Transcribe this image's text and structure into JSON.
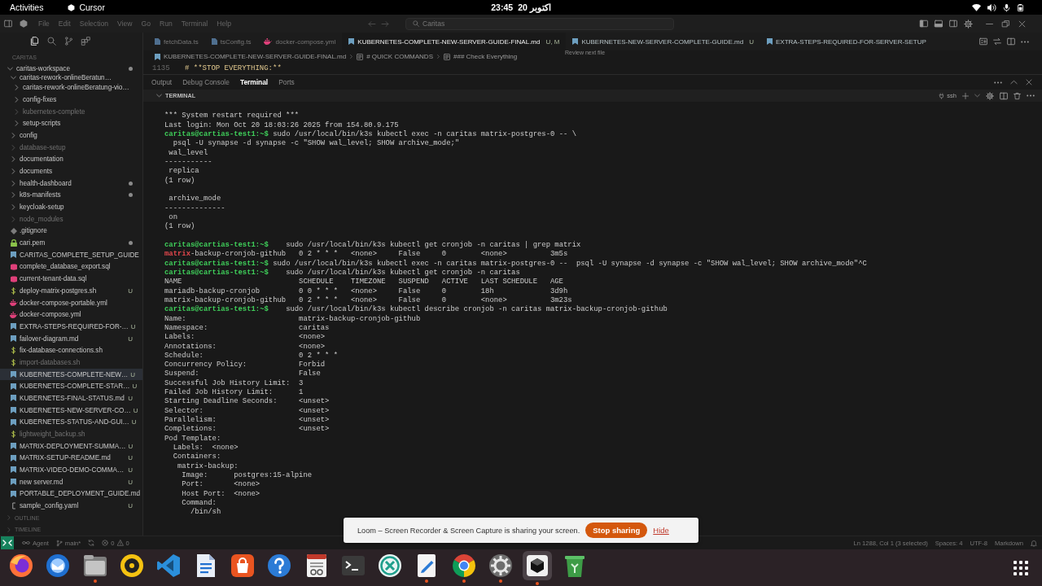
{
  "top_bar": {
    "activities": "Activities",
    "app": "Cursor",
    "time": "23:45",
    "date": "20 اکتوبر"
  },
  "title_bar": {
    "menu": [
      "File",
      "Edit",
      "Selection",
      "View",
      "Go",
      "Run",
      "Terminal",
      "Help"
    ],
    "command_center": "Caritas"
  },
  "sidebar": {
    "title": "CARITAS",
    "tree": [
      {
        "label": "caritas-workspace",
        "kind": "folder",
        "expanded": true,
        "selected": false,
        "dimmed": false,
        "dot": true,
        "children": [
          {
            "label": "caritas-rework-onlineBeratun…",
            "kind": "folder",
            "expanded": true,
            "selected": false,
            "dimmed": false,
            "dot": false,
            "children": [
              {
                "label": "caritas-rework-onlineBeratung-vio…",
                "kind": "folder",
                "expanded": false,
                "selected": false,
                "dimmed": false,
                "dot": false
              },
              {
                "label": "config-fixes",
                "kind": "folder",
                "expanded": false,
                "selected": false,
                "dimmed": false,
                "dot": false
              },
              {
                "label": "kubernetes-complete",
                "kind": "folder",
                "expanded": false,
                "selected": false,
                "dimmed": true,
                "dot": false
              },
              {
                "label": "setup-scripts",
                "kind": "folder",
                "expanded": false,
                "selected": false,
                "dimmed": false,
                "dot": false
              }
            ]
          },
          {
            "label": "config",
            "kind": "folder",
            "expanded": false,
            "selected": false,
            "dimmed": false,
            "dot": false
          },
          {
            "label": "database-setup",
            "kind": "folder",
            "expanded": false,
            "selected": false,
            "dimmed": true,
            "dot": false
          },
          {
            "label": "documentation",
            "kind": "folder",
            "expanded": false,
            "selected": false,
            "dimmed": false,
            "dot": false
          },
          {
            "label": "documents",
            "kind": "folder",
            "expanded": false,
            "selected": false,
            "dimmed": false,
            "dot": false
          },
          {
            "label": "health-dashboard",
            "kind": "folder",
            "expanded": false,
            "selected": false,
            "dimmed": false,
            "dot": true
          },
          {
            "label": "k8s-manifests",
            "kind": "folder",
            "expanded": false,
            "selected": false,
            "dimmed": false,
            "dot": true
          },
          {
            "label": "keycloak-setup",
            "kind": "folder",
            "expanded": false,
            "selected": false,
            "dimmed": false,
            "dot": false
          },
          {
            "label": "node_modules",
            "kind": "folder",
            "expanded": false,
            "selected": false,
            "dimmed": true,
            "dot": false
          },
          {
            "label": ".gitignore",
            "kind": "gitignore",
            "selected": false,
            "dimmed": false,
            "dot": false
          },
          {
            "label": "cari.pem",
            "kind": "pem",
            "selected": false,
            "dimmed": false,
            "dot": true
          },
          {
            "label": "CARITAS_COMPLETE_SETUP_GUIDE",
            "kind": "md",
            "selected": false,
            "dimmed": false,
            "dot": false
          },
          {
            "label": "complete_database_export.sql",
            "kind": "sql",
            "selected": false,
            "dimmed": false,
            "dot": false
          },
          {
            "label": "current-tenant-data.sql",
            "kind": "sql",
            "selected": false,
            "dimmed": false,
            "dot": false
          },
          {
            "label": "deploy-matrix-postgres.sh",
            "kind": "sh",
            "selected": false,
            "dimmed": false,
            "dot": false,
            "badge": "U"
          },
          {
            "label": "docker-compose-portable.yml",
            "kind": "docker",
            "selected": false,
            "dimmed": false,
            "dot": false
          },
          {
            "label": "docker-compose.yml",
            "kind": "docker",
            "selected": false,
            "dimmed": false,
            "dot": false
          },
          {
            "label": "EXTRA-STEPS-REQUIRED-FOR-…",
            "kind": "md",
            "selected": false,
            "dimmed": false,
            "dot": false,
            "badge": "U"
          },
          {
            "label": "failover-diagram.md",
            "kind": "md",
            "selected": false,
            "dimmed": false,
            "dot": false,
            "badge": "U"
          },
          {
            "label": "fix-database-connections.sh",
            "kind": "sh",
            "selected": false,
            "dimmed": false,
            "dot": false
          },
          {
            "label": "import-databases.sh",
            "kind": "sh",
            "selected": false,
            "dimmed": true,
            "dot": false
          },
          {
            "label": "KUBERNETES-COMPLETE-NEW…",
            "kind": "md",
            "selected": true,
            "dimmed": false,
            "dot": false,
            "badge": "U"
          },
          {
            "label": "KUBERNETES-COMPLETE-STAR…",
            "kind": "md",
            "selected": false,
            "dimmed": false,
            "dot": false,
            "badge": "U"
          },
          {
            "label": "KUBERNETES-FINAL-STATUS.md",
            "kind": "md",
            "selected": false,
            "dimmed": false,
            "dot": false,
            "badge": "U"
          },
          {
            "label": "KUBERNETES-NEW-SERVER-CO…",
            "kind": "md",
            "selected": false,
            "dimmed": false,
            "dot": false,
            "badge": "U"
          },
          {
            "label": "KUBERNETES-STATUS-AND-GUI…",
            "kind": "md",
            "selected": false,
            "dimmed": false,
            "dot": false,
            "badge": "U"
          },
          {
            "label": "lightweight_backup.sh",
            "kind": "sh",
            "selected": false,
            "dimmed": true,
            "dot": false
          },
          {
            "label": "MATRIX-DEPLOYMENT-SUMMA…",
            "kind": "md",
            "selected": false,
            "dimmed": false,
            "dot": false,
            "badge": "U"
          },
          {
            "label": "MATRIX-SETUP-README.md",
            "kind": "md",
            "selected": false,
            "dimmed": false,
            "dot": false,
            "badge": "U"
          },
          {
            "label": "MATRIX-VIDEO-DEMO-COMMA…",
            "kind": "md",
            "selected": false,
            "dimmed": false,
            "dot": false,
            "badge": "U"
          },
          {
            "label": "new server.md",
            "kind": "md",
            "selected": false,
            "dimmed": false,
            "dot": false,
            "badge": "U"
          },
          {
            "label": "PORTABLE_DEPLOYMENT_GUIDE.md",
            "kind": "md",
            "selected": false,
            "dimmed": false,
            "dot": false
          },
          {
            "label": "sample_config.yaml",
            "kind": "yaml",
            "selected": false,
            "dimmed": false,
            "dot": false,
            "badge": "U"
          }
        ]
      }
    ],
    "sections": [
      {
        "label": "OUTLINE",
        "expanded": false
      },
      {
        "label": "TIMELINE",
        "expanded": false
      }
    ]
  },
  "tabs": [
    {
      "label": "fetchData.ts",
      "kind": "code",
      "selected": false,
      "dimmed": true
    },
    {
      "label": "tsConfig.ts",
      "kind": "code",
      "selected": false,
      "dimmed": true
    },
    {
      "label": "docker-compose.yml",
      "kind": "docker",
      "selected": false,
      "dimmed": true
    },
    {
      "label": "KUBERNETES-COMPLETE-NEW-SERVER-GUIDE-FINAL.md",
      "kind": "md",
      "selected": true,
      "dimmed": false,
      "status": "U, M"
    },
    {
      "label": "KUBERNETES-NEW-SERVER-COMPLETE-GUIDE.md",
      "kind": "md",
      "selected": false,
      "dimmed": false,
      "status": "U"
    },
    {
      "label": "EXTRA-STEPS-REQUIRED-FOR-SERVER-SETUP",
      "kind": "md",
      "selected": false,
      "dimmed": false
    }
  ],
  "tooltip": "Review next file",
  "breadcrumbs": [
    {
      "kind": "file",
      "label": "KUBERNETES-COMPLETE-NEW-SERVER-GUIDE-FINAL.md"
    },
    {
      "kind": "heading",
      "label": "# QUICK COMMANDS"
    },
    {
      "kind": "heading",
      "label": "### Check Everything"
    }
  ],
  "editor_line": {
    "number": "1135",
    "code": "# **STOP EVERYTHING:**"
  },
  "panel": {
    "tabs": [
      {
        "label": "Output",
        "selected": false
      },
      {
        "label": "Debug Console",
        "selected": false
      },
      {
        "label": "Terminal",
        "selected": true
      },
      {
        "label": "Ports",
        "selected": false
      }
    ],
    "section": "TERMINAL",
    "shell": "ssh"
  },
  "terminal": {
    "lines": [
      {
        "kind": "output",
        "text": "*** System restart required ***"
      },
      {
        "kind": "output",
        "text": "Last login: Mon Oct 20 18:03:26 2025 from 154.80.9.175"
      },
      {
        "kind": "command",
        "prompt": "caritas@cartias-test1:~$",
        "text": " sudo /usr/local/bin/k3s kubectl exec -n caritas matrix-postgres-0 -- \\"
      },
      {
        "kind": "output",
        "text": "  psql -U synapse -d synapse -c \"SHOW wal_level; SHOW archive_mode;\""
      },
      {
        "kind": "output",
        "text": " wal_level"
      },
      {
        "kind": "output",
        "text": "-----------"
      },
      {
        "kind": "output",
        "text": " replica"
      },
      {
        "kind": "output",
        "text": "(1 row)"
      },
      {
        "kind": "blank"
      },
      {
        "kind": "output",
        "text": " archive_mode"
      },
      {
        "kind": "output",
        "text": "--------------"
      },
      {
        "kind": "output",
        "text": " on"
      },
      {
        "kind": "output",
        "text": "(1 row)"
      },
      {
        "kind": "blank"
      },
      {
        "kind": "command",
        "prompt": "caritas@cartias-test1:~$",
        "text": "    sudo /usr/local/bin/k3s kubectl get cronjob -n caritas | grep matrix"
      },
      {
        "kind": "match_row",
        "match": "matrix",
        "cells": [
          "-backup-cronjob-github",
          "0 2 * * *",
          "<none>",
          "False",
          "0",
          "<none>",
          "3m5s"
        ]
      },
      {
        "kind": "command",
        "prompt": "caritas@cartias-test1:~$",
        "text": " sudo /usr/local/bin/k3s kubectl exec -n caritas matrix-postgres-0 --  psql -U synapse -d synapse -c \"SHOW wal_level; SHOW archive_mode\"^C"
      },
      {
        "kind": "command",
        "prompt": "caritas@cartias-test1:~$",
        "text": "    sudo /usr/local/bin/k3s kubectl get cronjob -n caritas"
      },
      {
        "kind": "table_row",
        "cells": [
          "NAME",
          "SCHEDULE",
          "TIMEZONE",
          "SUSPEND",
          "ACTIVE",
          "LAST SCHEDULE",
          "AGE"
        ]
      },
      {
        "kind": "table_row",
        "cells": [
          "mariadb-backup-cronjob",
          "0 0 * * *",
          "<none>",
          "False",
          "0",
          "18h",
          "3d9h"
        ]
      },
      {
        "kind": "table_row",
        "cells": [
          "matrix-backup-cronjob-github",
          "0 2 * * *",
          "<none>",
          "False",
          "0",
          "<none>",
          "3m23s"
        ]
      },
      {
        "kind": "command",
        "prompt": "caritas@cartias-test1:~$",
        "text": "    sudo /usr/local/bin/k3s kubectl describe cronjob -n caritas matrix-backup-cronjob-github"
      },
      {
        "kind": "field",
        "key": "Name:",
        "value": "matrix-backup-cronjob-github"
      },
      {
        "kind": "field",
        "key": "Namespace:",
        "value": "caritas"
      },
      {
        "kind": "field",
        "key": "Labels:",
        "value": "<none>"
      },
      {
        "kind": "field",
        "key": "Annotations:",
        "value": "<none>"
      },
      {
        "kind": "field",
        "key": "Schedule:",
        "value": "0 2 * * *"
      },
      {
        "kind": "field",
        "key": "Concurrency Policy:",
        "value": "Forbid"
      },
      {
        "kind": "field",
        "key": "Suspend:",
        "value": "False"
      },
      {
        "kind": "field",
        "key": "Successful Job History Limit:",
        "value": "3"
      },
      {
        "kind": "field",
        "key": "Failed Job History Limit:",
        "value": "1"
      },
      {
        "kind": "field",
        "key": "Starting Deadline Seconds:",
        "value": "<unset>"
      },
      {
        "kind": "field",
        "key": "Selector:",
        "value": "<unset>"
      },
      {
        "kind": "field",
        "key": "Parallelism:",
        "value": "<unset>"
      },
      {
        "kind": "field",
        "key": "Completions:",
        "value": "<unset>"
      },
      {
        "kind": "output",
        "text": "Pod Template:"
      },
      {
        "kind": "output",
        "text": "  Labels:  <none>"
      },
      {
        "kind": "output",
        "text": "  Containers:"
      },
      {
        "kind": "output",
        "text": "   matrix-backup:"
      },
      {
        "kind": "output",
        "text": "    Image:      postgres:15-alpine"
      },
      {
        "kind": "output",
        "text": "    Port:       <none>"
      },
      {
        "kind": "output",
        "text": "    Host Port:  <none>"
      },
      {
        "kind": "output",
        "text": "    Command:"
      },
      {
        "kind": "output",
        "text": "      /bin/sh"
      }
    ]
  },
  "status_bar": {
    "left": [
      {
        "kind": "remote"
      },
      {
        "kind": "agent",
        "label": "Agent"
      },
      {
        "kind": "branch",
        "label": "main*"
      },
      {
        "kind": "sync"
      },
      {
        "kind": "problems",
        "errors": "0",
        "warnings": "0"
      }
    ],
    "right": [
      {
        "kind": "text",
        "label": "Ln 1288, Col 1 (3 selected)"
      },
      {
        "kind": "text",
        "label": "Spaces: 4"
      },
      {
        "kind": "text",
        "label": "UTF-8"
      },
      {
        "kind": "language",
        "label": "Markdown"
      },
      {
        "kind": "bell"
      }
    ]
  },
  "notification": {
    "message": "Loom – Screen Recorder & Screen Capture is sharing your screen.",
    "button": "Stop sharing",
    "link": "Hide"
  },
  "dock": [
    {
      "kind": "firefox",
      "running": false,
      "focused": false
    },
    {
      "kind": "thunderbird",
      "running": false,
      "focused": false
    },
    {
      "kind": "files",
      "running": true,
      "focused": false
    },
    {
      "kind": "rhythmbox",
      "running": false,
      "focused": false
    },
    {
      "kind": "vscode",
      "running": false,
      "focused": false
    },
    {
      "kind": "writer",
      "running": false,
      "focused": false
    },
    {
      "kind": "appcenter",
      "running": false,
      "focused": false
    },
    {
      "kind": "help",
      "running": false,
      "focused": false
    },
    {
      "kind": "viewer",
      "running": false,
      "focused": false
    },
    {
      "kind": "terminal",
      "running": false,
      "focused": false
    },
    {
      "kind": "remote",
      "running": false,
      "focused": false
    },
    {
      "kind": "texteditor",
      "running": true,
      "focused": false
    },
    {
      "kind": "chrome",
      "running": true,
      "focused": false
    },
    {
      "kind": "settings",
      "running": true,
      "focused": false
    },
    {
      "kind": "cursor",
      "running": true,
      "focused": true
    },
    {
      "kind": "trash",
      "running": false,
      "focused": false
    }
  ]
}
